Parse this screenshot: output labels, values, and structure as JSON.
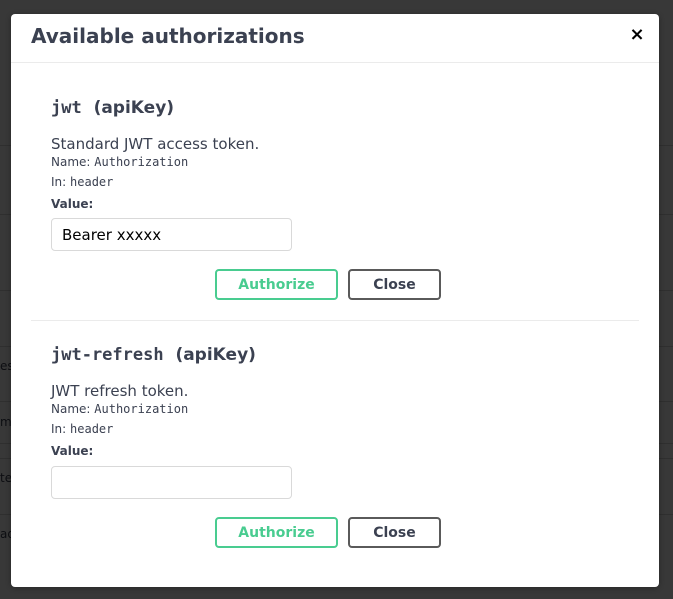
{
  "background": {
    "fragments": [
      "es",
      "m",
      "te",
      "ad"
    ]
  },
  "modal": {
    "title": "Available authorizations",
    "close_glyph": "×"
  },
  "auths": [
    {
      "name": "jwt",
      "type": "(apiKey)",
      "description": "Standard JWT access token.",
      "name_label": "Name:",
      "name_value": "Authorization",
      "in_label": "In:",
      "in_value": "header",
      "value_label": "Value:",
      "value": "Bearer xxxxx",
      "authorize_label": "Authorize",
      "close_label": "Close"
    },
    {
      "name": "jwt-refresh",
      "type": "(apiKey)",
      "description": "JWT refresh token.",
      "name_label": "Name:",
      "name_value": "Authorization",
      "in_label": "In:",
      "in_value": "header",
      "value_label": "Value:",
      "value": "",
      "authorize_label": "Authorize",
      "close_label": "Close"
    }
  ],
  "colors": {
    "authorize": "#49cc90",
    "text": "#3b4151",
    "overlay": "rgba(0,0,0,0.78)"
  }
}
